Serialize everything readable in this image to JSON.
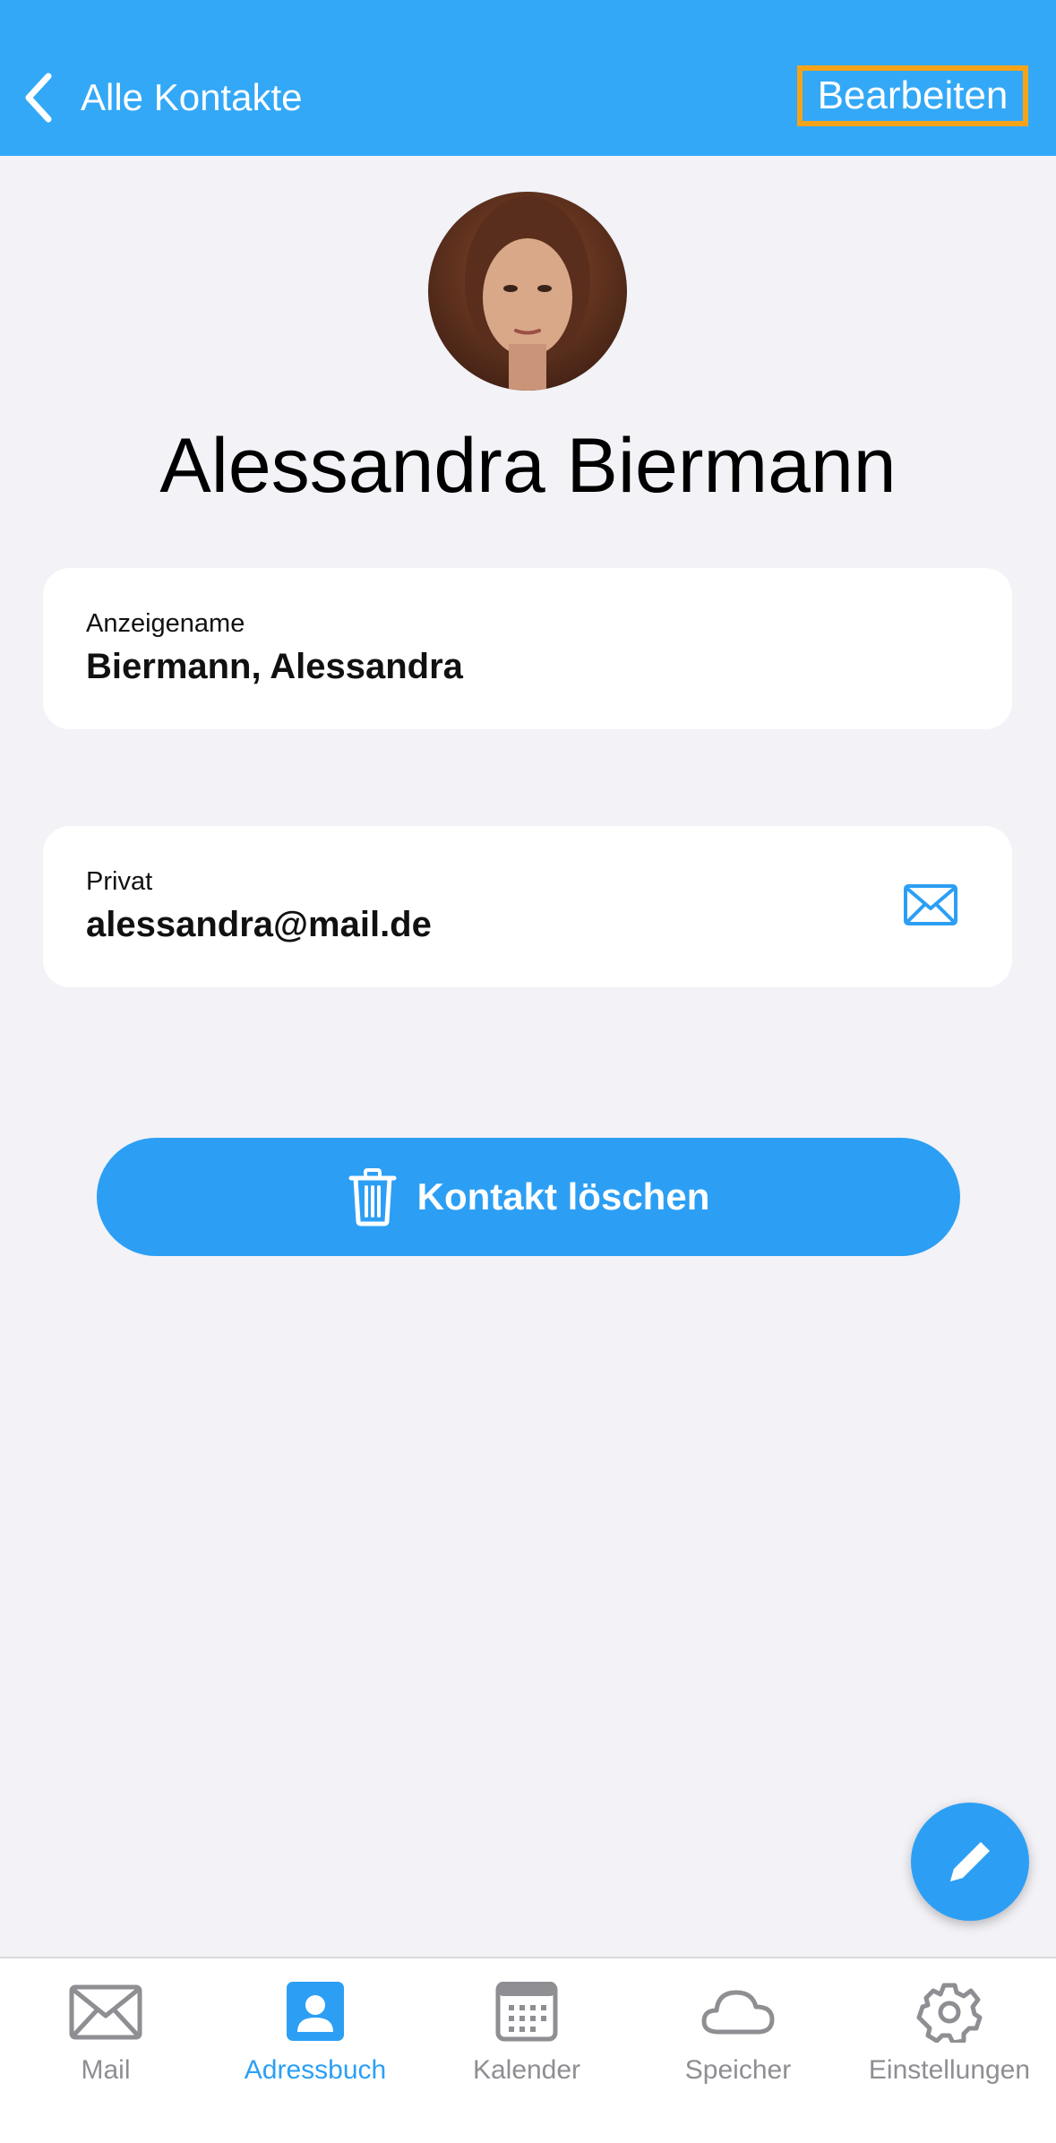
{
  "header": {
    "back_label": "Alle Kontakte",
    "edit_label": "Bearbeiten"
  },
  "contact": {
    "name": "Alessandra Biermann",
    "display_name_label": "Anzeigename",
    "display_name_value": "Biermann, Alessandra",
    "email_label": "Privat",
    "email_value": "alessandra@mail.de"
  },
  "actions": {
    "delete_label": "Kontakt löschen"
  },
  "tabs": [
    {
      "label": "Mail",
      "icon": "envelope-icon"
    },
    {
      "label": "Adressbuch",
      "icon": "person-icon",
      "active": true
    },
    {
      "label": "Kalender",
      "icon": "calendar-icon"
    },
    {
      "label": "Speicher",
      "icon": "cloud-icon"
    },
    {
      "label": "Einstellungen",
      "icon": "gear-icon"
    }
  ],
  "colors": {
    "accent": "#2c9ff5",
    "header": "#33a8f7",
    "highlight": "#f5a31a",
    "background": "#f2f2f7"
  }
}
